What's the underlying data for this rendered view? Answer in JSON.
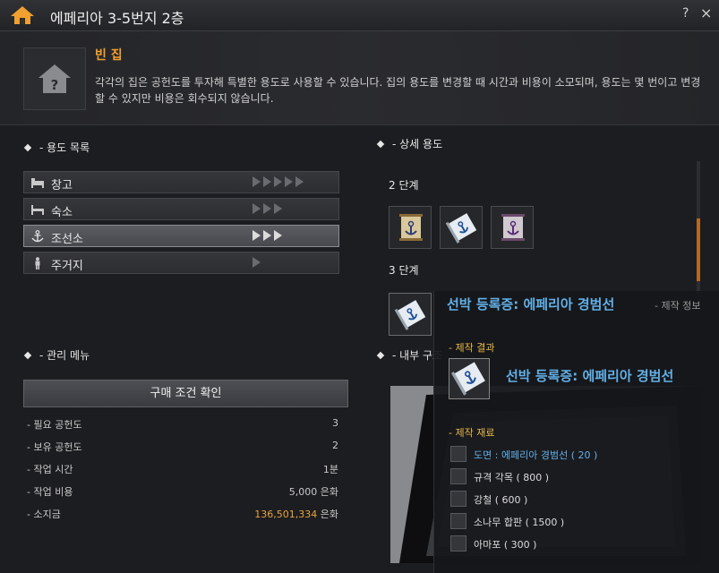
{
  "window": {
    "title": "에페리아 3-5번지 2층",
    "help_label": "?",
    "close_label": "×"
  },
  "info": {
    "title": "빈 집",
    "description": "각각의 집은 공헌도를 투자해 특별한 용도로 사용할 수 있습니다. 집의 용도를 변경할 때 시간과 비용이 소모되며, 용도는 몇 번이고 변경할 수 있지만 비용은 회수되지 않습니다."
  },
  "uses": {
    "header": "- 용도 목록",
    "items": [
      {
        "label": "창고",
        "icon": "bed-icon",
        "level": 5
      },
      {
        "label": "숙소",
        "icon": "bed-icon",
        "level": 3
      },
      {
        "label": "조선소",
        "icon": "anchor-icon",
        "level": 3
      },
      {
        "label": "주거지",
        "icon": "person-icon",
        "level": 1
      }
    ]
  },
  "manage": {
    "header": "- 관리 메뉴",
    "buy_button": "구매 조건 확인",
    "stats": [
      {
        "label": "- 필요 공헌도",
        "value": "3"
      },
      {
        "label": "- 보유 공헌도",
        "value": "2"
      },
      {
        "label": "- 작업 시간",
        "value": "1분"
      },
      {
        "label": "- 작업 비용",
        "value": "5,000 은화"
      },
      {
        "label": "- 소지금",
        "value_gold": "136,501,334",
        "value_suffix": " 은화"
      }
    ]
  },
  "detail": {
    "header": "- 상세 용도",
    "stage2": "2 단계",
    "stage3": "3 단계",
    "interior_header": "- 내부 구조"
  },
  "tooltip": {
    "title": "선박 등록증: 에페리아 경범선",
    "craft_info": "- 제작 정보",
    "result_header": "- 제작 결과",
    "result_name": "선박 등록증: 에페리아 경범선",
    "materials_header": "- 제작 재료",
    "materials": [
      {
        "label": "도면 : 에페리아 경범선 ( 20 )",
        "highlight": true
      },
      {
        "label": "규격 각목 ( 800 )",
        "highlight": false
      },
      {
        "label": "강철 ( 600 )",
        "highlight": false
      },
      {
        "label": "소나무 합판 ( 1500 )",
        "highlight": false
      },
      {
        "label": "아마포 ( 300 )",
        "highlight": false
      }
    ]
  },
  "colors": {
    "accent_gold": "#f0a030",
    "link_blue": "#62b0e8",
    "scroll_orange": "#b26a24"
  }
}
